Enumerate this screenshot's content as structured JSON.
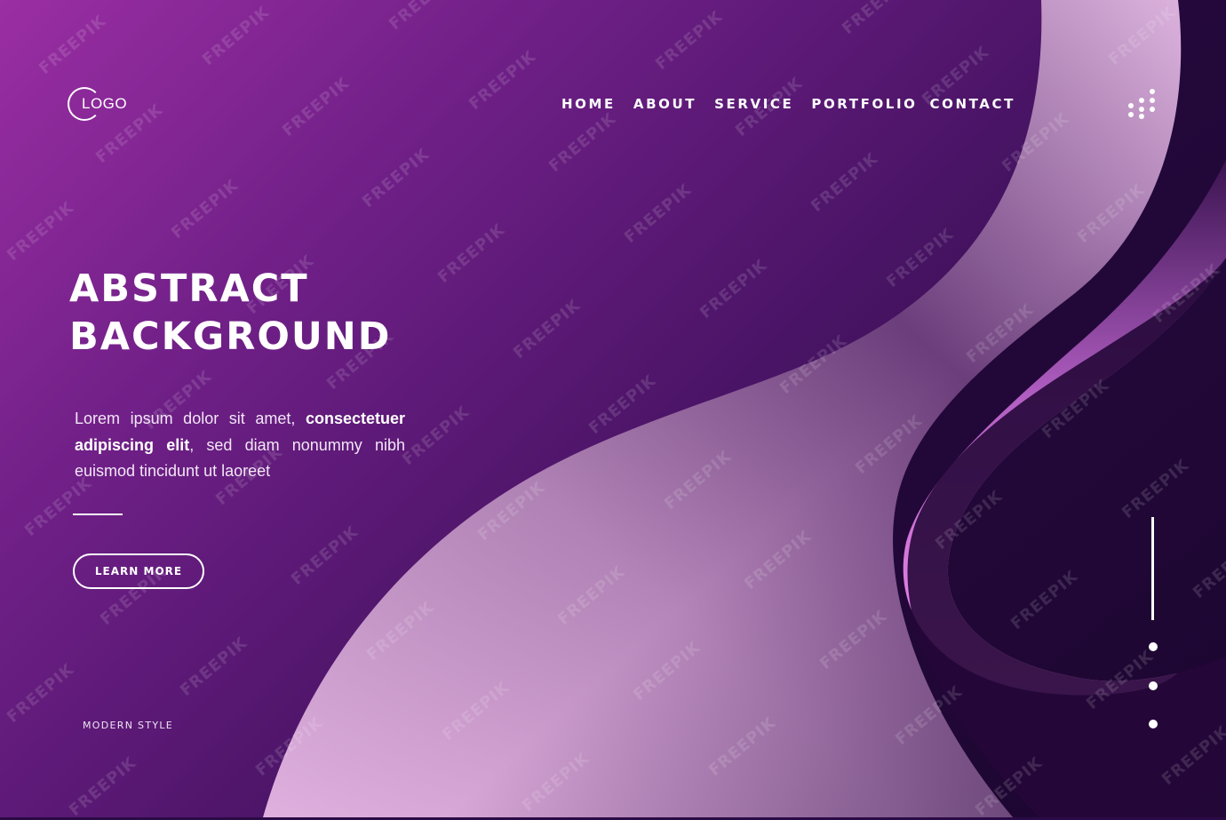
{
  "logo": {
    "text": "LOGO"
  },
  "nav": {
    "items": [
      {
        "label": "HOME"
      },
      {
        "label": "ABOUT"
      },
      {
        "label": "SERVICE"
      },
      {
        "label": "PORTFOLIO"
      },
      {
        "label": "CONTACT"
      }
    ]
  },
  "hero": {
    "title_line1": "ABSTRACT",
    "title_line2": "BACKGROUND",
    "body_plain_1": "Lorem ipsum dolor sit amet, ",
    "body_bold_1": "consectetuer adipiscing elit",
    "body_plain_2": ", sed diam nonummy nibh euismod tincidunt ut laoreet",
    "button_label": "LEARN MORE",
    "footer_label": "MODERN STYLE"
  },
  "watermark": {
    "text": "FREEPIK"
  },
  "icons": {
    "menu": "grid-dots-icon",
    "logo": "logo-ring-icon"
  },
  "colors": {
    "gradient_start": "#9a2ea3",
    "gradient_end": "#220838",
    "wave_light": "#d8a9d8",
    "wave_pink": "#f184e6",
    "text": "#ffffff"
  }
}
